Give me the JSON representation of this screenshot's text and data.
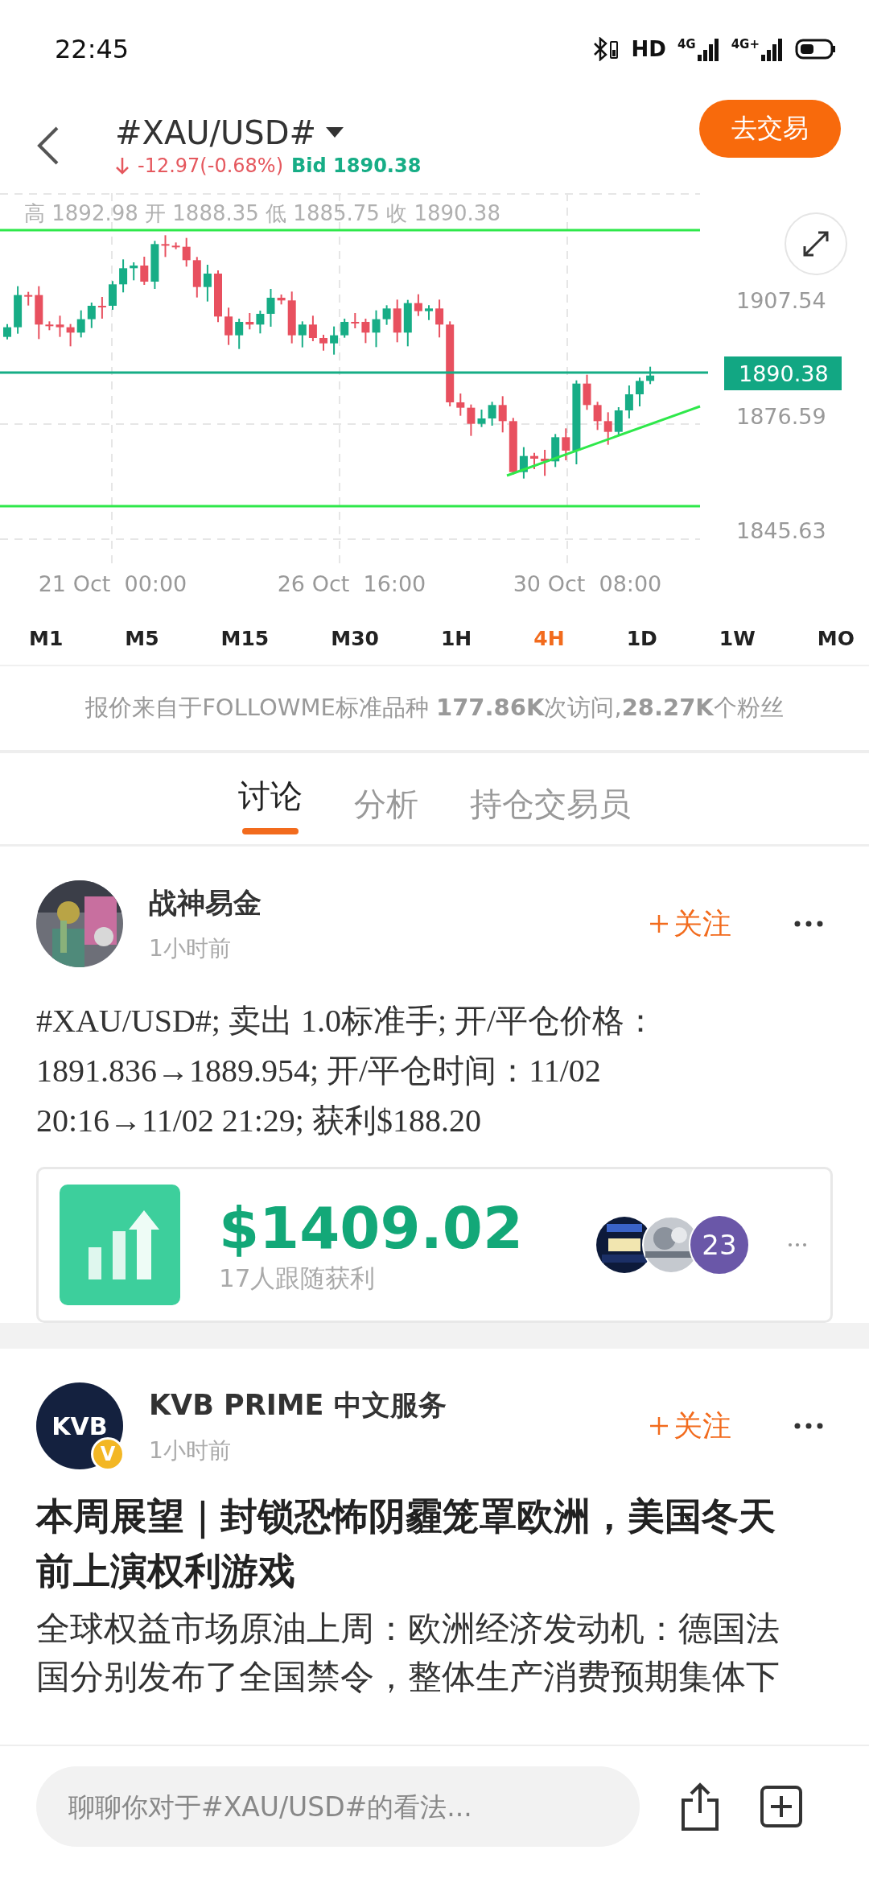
{
  "status_bar": {
    "time": "22:45",
    "hd_label": "HD",
    "network_labels": [
      "4G",
      "4G+"
    ]
  },
  "header": {
    "symbol": "#XAU/USD#",
    "change": "-12.97(-0.68%)",
    "bid": "Bid 1890.38",
    "trade_button": "去交易"
  },
  "chart": {
    "ohlc": "高 1892.98  开 1888.35  低 1885.75  收 1890.38",
    "y_labels": [
      "1907.54",
      "1876.59",
      "1845.63"
    ],
    "price_tag": "1890.38",
    "x_labels": [
      "21 Oct  00:00",
      "26 Oct  16:00",
      "30 Oct  08:00"
    ]
  },
  "timeframes": [
    {
      "label": "M1",
      "selected": false
    },
    {
      "label": "M5",
      "selected": false
    },
    {
      "label": "M15",
      "selected": false
    },
    {
      "label": "M30",
      "selected": false
    },
    {
      "label": "1H",
      "selected": false
    },
    {
      "label": "4H",
      "selected": true
    },
    {
      "label": "1D",
      "selected": false
    },
    {
      "label": "1W",
      "selected": false
    },
    {
      "label": "MO",
      "selected": false
    }
  ],
  "info": "报价来自于FOLLOWME标准品种 **177.86K**次访问,**28.27K**个粉丝",
  "tabs": [
    {
      "label": "讨论",
      "selected": true
    },
    {
      "label": "分析",
      "selected": false
    },
    {
      "label": "持仓交易员",
      "selected": false
    }
  ],
  "posts": [
    {
      "kind": "trade",
      "author": "战神易金",
      "time": "1小时前",
      "follow_label": "关注",
      "body": "#XAU/USD#; 卖出 1.0标准手; 开/平仓价格：1891.836→1889.954; 开/平仓时间：11/02 20:16→11/02 21:29; 获利$188.20",
      "profit": {
        "amount": "$1409.02",
        "caption": "17人跟随获利",
        "more_count": "23"
      }
    },
    {
      "kind": "article",
      "author": "KVB PRIME 中文服务",
      "avatar_text": "KVB",
      "verified": true,
      "verified_mark": "V",
      "time": "1小时前",
      "follow_label": "关注",
      "title": "本周展望｜封锁恐怖阴霾笼罩欧洲，美国冬天前上演权利游戏",
      "excerpt": "全球权益市场原油上周：欧洲经济发动机：德国法国分别发布了全国禁令，整体生产消费预期集体下"
    }
  ],
  "comment_bar": {
    "placeholder": "聊聊你对于#XAU/USD#的看法..."
  }
}
